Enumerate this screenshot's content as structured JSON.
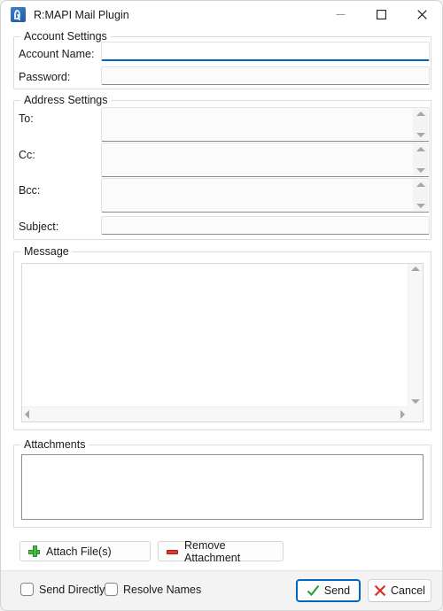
{
  "window": {
    "title": "R:MAPI Mail Plugin",
    "icon": "r-logo-icon",
    "controls": {
      "minimize": "minimize-icon",
      "maximize": "maximize-icon",
      "close": "close-icon"
    }
  },
  "account_settings": {
    "group_label": "Account Settings",
    "fields": [
      {
        "label": "Account Name:",
        "value": "",
        "placeholder": "",
        "focused": true
      },
      {
        "label": "Password:",
        "value": "",
        "placeholder": "",
        "focused": false
      }
    ]
  },
  "address_settings": {
    "group_label": "Address Settings",
    "fields": [
      {
        "label": "To:",
        "value": "",
        "placeholder": ""
      },
      {
        "label": "Cc:",
        "value": "",
        "placeholder": ""
      },
      {
        "label": "Bcc:",
        "value": "",
        "placeholder": ""
      }
    ],
    "subject": {
      "label": "Subject:",
      "value": "",
      "placeholder": ""
    }
  },
  "message": {
    "group_label": "Message",
    "value": "",
    "placeholder": ""
  },
  "attachments": {
    "group_label": "Attachments",
    "items": [],
    "attach_button": "Attach File(s)",
    "remove_button": "Remove Attachment"
  },
  "footer": {
    "checkboxes": [
      {
        "label": "Send Directly",
        "checked": false
      },
      {
        "label": "Resolve Names",
        "checked": false
      }
    ],
    "send_button": "Send",
    "cancel_button": "Cancel"
  },
  "colors": {
    "accent": "#0067c0",
    "check_green": "#2a9d3f",
    "cancel_red": "#e02a20",
    "plus_green": "#4cb944",
    "minus_red": "#e23a2e"
  }
}
